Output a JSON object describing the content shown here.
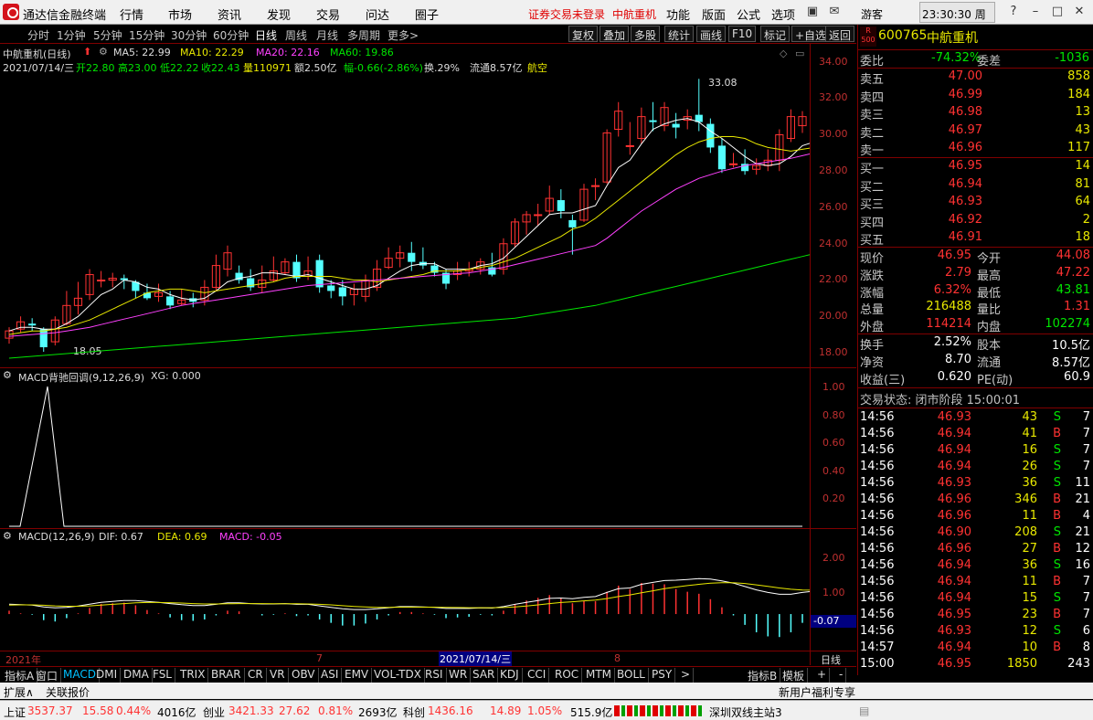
{
  "app_title": "通达信金融终端",
  "menu": [
    "行情",
    "市场",
    "资讯",
    "发现",
    "交易",
    "问达",
    "圈子"
  ],
  "menu_right": [
    "功能",
    "版面",
    "公式",
    "选项"
  ],
  "trade_warning": "证券交易未登录",
  "menu_stock": "中航重机",
  "guest": "游客",
  "clock": "23:30:30 周三",
  "periods": [
    "分时",
    "1分钟",
    "5分钟",
    "15分钟",
    "30分钟",
    "60分钟",
    "日线",
    "周线",
    "月线",
    "多周期",
    "更多>"
  ],
  "toolbar_buttons": [
    "复权",
    "叠加",
    "多股",
    "统计",
    "画线",
    "F10",
    "标记",
    "+自选",
    "返回"
  ],
  "chart_header": {
    "name": "中航重机(日线)",
    "ma5": "MA5: 22.99",
    "ma10": "MA10: 22.29",
    "ma20": "MA20: 22.16",
    "ma60": "MA60: 19.86",
    "info_date": "2021/07/14/三",
    "info_open": "开22.80",
    "info_high": "高23.00",
    "info_low": "低22.22",
    "info_close": "收22.43",
    "info_vol": "量110971",
    "info_amt": "额2.50亿",
    "info_chg": "幅-0.66(-2.86%)",
    "info_turn": "换.29%",
    "info_float": "流通8.57亿",
    "info_sector": "航空"
  },
  "price_axis": [
    "34.00",
    "32.00",
    "30.00",
    "28.00",
    "26.00",
    "24.00",
    "22.00",
    "20.00",
    "18.00"
  ],
  "high_label": "33.08",
  "low_label": "18.05",
  "indicator1": {
    "title": "MACD背驰回调(9,12,26,9)",
    "xg": "XG: 0.000",
    "axis": [
      "1.00",
      "0.80",
      "0.60",
      "0.40",
      "0.20"
    ]
  },
  "indicator2": {
    "title": "MACD(12,26,9)",
    "dif": "DIF: 0.67",
    "dea": "DEA: 0.69",
    "macd": "MACD: -0.05",
    "axis": [
      "2.00",
      "1.00"
    ],
    "current": "-0.07"
  },
  "date_axis": {
    "year": "2021年",
    "m7": "7",
    "cursor": "2021/07/14/三",
    "m8": "8",
    "period_label": "日线"
  },
  "indicator_tabs": [
    "指标A",
    "窗口",
    "MACD",
    "DMI",
    "DMA",
    "FSL",
    "TRIX",
    "BRAR",
    "CR",
    "VR",
    "OBV",
    "ASI",
    "EMV",
    "VOL-TDX",
    "RSI",
    "WR",
    "SAR",
    "KDJ",
    "CCI",
    "ROC",
    "MTM",
    "BOLL",
    "PSY",
    ">"
  ],
  "right_tabs": [
    "指标B",
    "模板",
    "+",
    "-"
  ],
  "sub_links": [
    "扩展∧",
    "关联报价"
  ],
  "promo": "新用户福利专享",
  "quote": {
    "code": "600765",
    "name": "中航重机",
    "weibi_label": "委比",
    "weibi": "-74.32%",
    "weicha_label": "委差",
    "weicha": "-1036",
    "asks": [
      {
        "label": "卖五",
        "price": "47.00",
        "vol": "858"
      },
      {
        "label": "卖四",
        "price": "46.99",
        "vol": "184"
      },
      {
        "label": "卖三",
        "price": "46.98",
        "vol": "13"
      },
      {
        "label": "卖二",
        "price": "46.97",
        "vol": "43"
      },
      {
        "label": "卖一",
        "price": "46.96",
        "vol": "117"
      }
    ],
    "bids": [
      {
        "label": "买一",
        "price": "46.95",
        "vol": "14"
      },
      {
        "label": "买二",
        "price": "46.94",
        "vol": "81"
      },
      {
        "label": "买三",
        "price": "46.93",
        "vol": "64"
      },
      {
        "label": "买四",
        "price": "46.92",
        "vol": "2"
      },
      {
        "label": "买五",
        "price": "46.91",
        "vol": "18"
      }
    ],
    "stats": [
      {
        "k1": "现价",
        "v1": "46.95",
        "k2": "今开",
        "v2": "44.08",
        "c1": "red",
        "c2": "red"
      },
      {
        "k1": "涨跌",
        "v1": "2.79",
        "k2": "最高",
        "v2": "47.22",
        "c1": "red",
        "c2": "red"
      },
      {
        "k1": "涨幅",
        "v1": "6.32%",
        "k2": "最低",
        "v2": "43.81",
        "c1": "red",
        "c2": "green"
      },
      {
        "k1": "总量",
        "v1": "216488",
        "k2": "量比",
        "v2": "1.31",
        "c1": "yellow",
        "c2": "red"
      },
      {
        "k1": "外盘",
        "v1": "114214",
        "k2": "内盘",
        "v2": "102274",
        "c1": "red",
        "c2": "green"
      }
    ],
    "stats2": [
      {
        "k1": "换手",
        "v1": "2.52%",
        "k2": "股本",
        "v2": "10.5亿"
      },
      {
        "k1": "净资",
        "v1": "8.70",
        "k2": "流通",
        "v2": "8.57亿"
      },
      {
        "k1": "收益(三)",
        "v1": "0.620",
        "k2": "PE(动)",
        "v2": "60.9"
      }
    ],
    "trade_status": "交易状态: 闭市阶段 15:00:01",
    "ticks": [
      {
        "t": "14:56",
        "p": "46.93",
        "v": "43",
        "d": "S",
        "n": "7"
      },
      {
        "t": "14:56",
        "p": "46.94",
        "v": "41",
        "d": "B",
        "n": "7"
      },
      {
        "t": "14:56",
        "p": "46.94",
        "v": "16",
        "d": "S",
        "n": "7"
      },
      {
        "t": "14:56",
        "p": "46.94",
        "v": "26",
        "d": "S",
        "n": "7"
      },
      {
        "t": "14:56",
        "p": "46.93",
        "v": "36",
        "d": "S",
        "n": "11"
      },
      {
        "t": "14:56",
        "p": "46.96",
        "v": "346",
        "d": "B",
        "n": "21"
      },
      {
        "t": "14:56",
        "p": "46.96",
        "v": "11",
        "d": "B",
        "n": "4"
      },
      {
        "t": "14:56",
        "p": "46.90",
        "v": "208",
        "d": "S",
        "n": "21"
      },
      {
        "t": "14:56",
        "p": "46.96",
        "v": "27",
        "d": "B",
        "n": "12"
      },
      {
        "t": "14:56",
        "p": "46.94",
        "v": "36",
        "d": "S",
        "n": "16"
      },
      {
        "t": "14:56",
        "p": "46.94",
        "v": "11",
        "d": "B",
        "n": "7"
      },
      {
        "t": "14:56",
        "p": "46.94",
        "v": "15",
        "d": "S",
        "n": "7"
      },
      {
        "t": "14:56",
        "p": "46.95",
        "v": "23",
        "d": "B",
        "n": "7"
      },
      {
        "t": "14:56",
        "p": "46.93",
        "v": "12",
        "d": "S",
        "n": "6"
      },
      {
        "t": "14:57",
        "p": "46.94",
        "v": "10",
        "d": "B",
        "n": "8"
      },
      {
        "t": "15:00",
        "p": "46.95",
        "v": "1850",
        "d": "",
        "n": "243"
      }
    ]
  },
  "status_bar": {
    "sh_label": "上证",
    "sh": "3537.37",
    "sh_chg": "15.58",
    "sh_pct": "0.44%",
    "sh_amt": "4016亿",
    "cy_label": "创业",
    "cy": "3421.33",
    "cy_chg": "27.62",
    "cy_pct": "0.81%",
    "cy_amt": "2693亿",
    "kc_label": "科创",
    "kc": "1436.16",
    "kc_chg": "14.89",
    "kc_pct": "1.05%",
    "kc_amt": "515.9亿",
    "server": "深圳双线主站3"
  },
  "chart_data": {
    "type": "candlestick",
    "y_range": [
      17,
      35
    ],
    "candles": [
      {
        "o": 18.8,
        "c": 19.2,
        "h": 19.4,
        "l": 18.5
      },
      {
        "o": 19.3,
        "c": 19.7,
        "h": 20.0,
        "l": 19.1
      },
      {
        "o": 19.6,
        "c": 19.5,
        "h": 19.9,
        "l": 19.2
      },
      {
        "o": 19.3,
        "c": 18.3,
        "h": 19.4,
        "l": 18.05
      },
      {
        "o": 18.6,
        "c": 19.8,
        "h": 20.0,
        "l": 18.4
      },
      {
        "o": 19.6,
        "c": 20.6,
        "h": 21.4,
        "l": 19.5
      },
      {
        "o": 20.6,
        "c": 21.0,
        "h": 21.9,
        "l": 20.1
      },
      {
        "o": 21.2,
        "c": 22.3,
        "h": 22.6,
        "l": 20.9
      },
      {
        "o": 22.0,
        "c": 22.0,
        "h": 22.5,
        "l": 21.6
      },
      {
        "o": 22.0,
        "c": 22.1,
        "h": 22.4,
        "l": 21.6
      },
      {
        "o": 22.1,
        "c": 22.0,
        "h": 22.3,
        "l": 21.5
      },
      {
        "o": 21.9,
        "c": 21.4,
        "h": 22.0,
        "l": 21.0
      },
      {
        "o": 21.3,
        "c": 21.0,
        "h": 21.8,
        "l": 20.9
      },
      {
        "o": 21.1,
        "c": 21.3,
        "h": 21.8,
        "l": 20.8
      },
      {
        "o": 21.1,
        "c": 20.6,
        "h": 21.4,
        "l": 20.4
      },
      {
        "o": 20.7,
        "c": 20.9,
        "h": 21.5,
        "l": 20.6
      },
      {
        "o": 21.0,
        "c": 20.8,
        "h": 21.3,
        "l": 20.5
      },
      {
        "o": 20.9,
        "c": 21.6,
        "h": 22.0,
        "l": 20.6
      },
      {
        "o": 21.6,
        "c": 22.8,
        "h": 23.4,
        "l": 21.4
      },
      {
        "o": 22.6,
        "c": 23.5,
        "h": 23.9,
        "l": 22.2
      },
      {
        "o": 22.4,
        "c": 22.0,
        "h": 22.8,
        "l": 21.8
      },
      {
        "o": 22.1,
        "c": 21.6,
        "h": 22.6,
        "l": 21.4
      },
      {
        "o": 21.6,
        "c": 22.0,
        "h": 22.8,
        "l": 21.3
      },
      {
        "o": 22.0,
        "c": 22.5,
        "h": 23.3,
        "l": 21.9
      },
      {
        "o": 22.4,
        "c": 23.0,
        "h": 23.2,
        "l": 22.3
      },
      {
        "o": 23.0,
        "c": 22.1,
        "h": 23.4,
        "l": 21.9
      },
      {
        "o": 22.2,
        "c": 22.5,
        "h": 23.3,
        "l": 22.0
      },
      {
        "o": 23.1,
        "c": 21.6,
        "h": 23.4,
        "l": 21.3
      },
      {
        "o": 21.7,
        "c": 21.4,
        "h": 22.0,
        "l": 21.0
      },
      {
        "o": 21.6,
        "c": 21.1,
        "h": 22.0,
        "l": 20.6
      },
      {
        "o": 21.2,
        "c": 21.5,
        "h": 21.8,
        "l": 20.6
      },
      {
        "o": 21.1,
        "c": 22.0,
        "h": 22.3,
        "l": 20.8
      },
      {
        "o": 21.6,
        "c": 22.6,
        "h": 23.1,
        "l": 21.4
      },
      {
        "o": 22.7,
        "c": 23.2,
        "h": 23.8,
        "l": 22.6
      },
      {
        "o": 23.2,
        "c": 23.5,
        "h": 23.9,
        "l": 22.7
      },
      {
        "o": 23.5,
        "c": 23.0,
        "h": 24.1,
        "l": 22.5
      },
      {
        "o": 23.0,
        "c": 22.8,
        "h": 23.8,
        "l": 22.6
      },
      {
        "o": 22.8,
        "c": 22.4,
        "h": 23.0,
        "l": 22.2
      },
      {
        "o": 22.4,
        "c": 21.8,
        "h": 22.6,
        "l": 21.5
      },
      {
        "o": 22.3,
        "c": 22.5,
        "h": 23.0,
        "l": 22.0
      },
      {
        "o": 22.5,
        "c": 22.6,
        "h": 23.0,
        "l": 22.2
      },
      {
        "o": 22.6,
        "c": 23.0,
        "h": 23.2,
        "l": 22.3
      },
      {
        "o": 22.7,
        "c": 22.3,
        "h": 23.5,
        "l": 22.2
      },
      {
        "o": 22.6,
        "c": 24.0,
        "h": 24.3,
        "l": 22.3
      },
      {
        "o": 24.0,
        "c": 25.2,
        "h": 25.4,
        "l": 23.8
      },
      {
        "o": 25.2,
        "c": 25.6,
        "h": 25.8,
        "l": 24.5
      },
      {
        "o": 25.6,
        "c": 25.6,
        "h": 26.2,
        "l": 25.0
      },
      {
        "o": 25.8,
        "c": 26.5,
        "h": 27.2,
        "l": 25.6
      },
      {
        "o": 26.4,
        "c": 25.8,
        "h": 27.0,
        "l": 25.4
      },
      {
        "o": 25.3,
        "c": 24.9,
        "h": 25.6,
        "l": 23.4
      },
      {
        "o": 25.3,
        "c": 27.0,
        "h": 27.3,
        "l": 25.2
      },
      {
        "o": 27.2,
        "c": 27.2,
        "h": 27.6,
        "l": 26.4
      },
      {
        "o": 27.4,
        "c": 30.1,
        "h": 30.3,
        "l": 27.3
      },
      {
        "o": 30.3,
        "c": 31.3,
        "h": 31.8,
        "l": 29.9
      },
      {
        "o": 29.4,
        "c": 29.4,
        "h": 30.7,
        "l": 28.9
      },
      {
        "o": 29.8,
        "c": 31.0,
        "h": 31.5,
        "l": 29.5
      },
      {
        "o": 30.8,
        "c": 30.7,
        "h": 31.8,
        "l": 30.2
      },
      {
        "o": 30.5,
        "c": 31.5,
        "h": 31.8,
        "l": 30.2
      },
      {
        "o": 30.6,
        "c": 30.4,
        "h": 31.2,
        "l": 29.8
      },
      {
        "o": 30.8,
        "c": 31.0,
        "h": 31.4,
        "l": 30.3
      },
      {
        "o": 31.1,
        "c": 30.7,
        "h": 33.08,
        "l": 30.2
      },
      {
        "o": 30.6,
        "c": 29.3,
        "h": 30.9,
        "l": 29.0
      },
      {
        "o": 29.4,
        "c": 28.1,
        "h": 29.8,
        "l": 27.9
      },
      {
        "o": 28.4,
        "c": 28.4,
        "h": 29.0,
        "l": 28.2
      },
      {
        "o": 28.4,
        "c": 28.0,
        "h": 29.2,
        "l": 27.8
      },
      {
        "o": 28.1,
        "c": 28.3,
        "h": 28.7,
        "l": 27.8
      },
      {
        "o": 28.3,
        "c": 28.6,
        "h": 29.2,
        "l": 28.0
      },
      {
        "o": 28.6,
        "c": 30.0,
        "h": 30.3,
        "l": 28.0
      },
      {
        "o": 29.8,
        "c": 31.0,
        "h": 31.4,
        "l": 29.6
      },
      {
        "o": 30.5,
        "c": 31.0,
        "h": 31.3,
        "l": 30.1
      }
    ],
    "ma5": [
      19.2,
      19.4,
      19.4,
      19.3,
      19.3,
      19.6,
      20.0,
      20.6,
      21.2,
      21.5,
      22.0,
      21.9,
      21.6,
      21.5,
      21.2,
      21.0,
      20.9,
      21.0,
      21.4,
      21.9,
      22.1,
      22.2,
      22.4,
      22.4,
      22.3,
      22.2,
      22.3,
      22.1,
      21.9,
      21.7,
      21.5,
      21.5,
      21.7,
      22.1,
      22.5,
      22.8,
      22.9,
      22.9,
      22.6,
      22.6,
      22.6,
      22.8,
      22.9,
      23.2,
      23.8,
      24.4,
      25.0,
      25.6,
      25.7,
      25.7,
      25.9,
      26.1,
      27.2,
      28.2,
      28.6,
      29.5,
      30.3,
      30.6,
      30.8,
      30.9,
      30.7,
      30.2,
      29.8,
      29.3,
      28.8,
      28.4,
      28.3,
      28.4,
      28.8,
      29.4,
      29.6
    ],
    "ma10": [
      19.0,
      19.1,
      19.2,
      19.2,
      19.3,
      19.4,
      19.6,
      19.8,
      20.1,
      20.4,
      20.7,
      21.0,
      21.3,
      21.4,
      21.5,
      21.5,
      21.4,
      21.3,
      21.4,
      21.5,
      21.6,
      21.7,
      21.8,
      21.9,
      22.1,
      22.2,
      22.2,
      22.2,
      22.2,
      22.1,
      22.0,
      22.0,
      21.9,
      22.0,
      22.1,
      22.2,
      22.3,
      22.5,
      22.5,
      22.5,
      22.6,
      22.7,
      22.8,
      23.0,
      23.2,
      23.5,
      23.8,
      24.1,
      24.4,
      24.8,
      25.0,
      25.4,
      25.9,
      26.4,
      26.9,
      27.4,
      27.9,
      28.4,
      28.9,
      29.3,
      29.6,
      29.8,
      29.9,
      29.9,
      29.8,
      29.5,
      29.3,
      29.2,
      29.1,
      29.2,
      29.3
    ],
    "ma20": [
      18.9,
      18.95,
      19.0,
      19.05,
      19.1,
      19.2,
      19.3,
      19.4,
      19.55,
      19.7,
      19.85,
      20.0,
      20.15,
      20.3,
      20.45,
      20.6,
      20.7,
      20.8,
      20.9,
      21.0,
      21.1,
      21.2,
      21.3,
      21.4,
      21.5,
      21.6,
      21.7,
      21.75,
      21.8,
      21.85,
      21.9,
      21.95,
      22.0,
      22.05,
      22.1,
      22.15,
      22.2,
      22.25,
      22.3,
      22.35,
      22.4,
      22.5,
      22.6,
      22.7,
      22.85,
      23.0,
      23.15,
      23.3,
      23.45,
      23.6,
      23.75,
      23.9,
      24.3,
      24.8,
      25.3,
      25.8,
      26.2,
      26.6,
      27.0,
      27.3,
      27.6,
      27.8,
      28.0,
      28.15,
      28.3,
      28.4,
      28.5,
      28.6,
      28.7,
      28.85,
      29.0
    ],
    "ma60": [
      17.7,
      17.75,
      17.8,
      17.85,
      17.9,
      17.95,
      18.0,
      18.05,
      18.1,
      18.15,
      18.2,
      18.25,
      18.3,
      18.35,
      18.4,
      18.45,
      18.5,
      18.55,
      18.6,
      18.65,
      18.7,
      18.75,
      18.8,
      18.85,
      18.9,
      18.95,
      19.0,
      19.05,
      19.1,
      19.15,
      19.2,
      19.25,
      19.3,
      19.35,
      19.4,
      19.45,
      19.5,
      19.55,
      19.6,
      19.65,
      19.7,
      19.75,
      19.8,
      19.85,
      19.9,
      20.0,
      20.1,
      20.2,
      20.3,
      20.4,
      20.5,
      20.6,
      20.75,
      20.9,
      21.05,
      21.2,
      21.35,
      21.5,
      21.65,
      21.8,
      21.95,
      22.1,
      22.25,
      22.4,
      22.55,
      22.7,
      22.85,
      23.0,
      23.15,
      23.3,
      23.45
    ],
    "dif": [
      0.35,
      0.32,
      0.3,
      0.2,
      0.15,
      0.18,
      0.25,
      0.35,
      0.45,
      0.5,
      0.55,
      0.55,
      0.5,
      0.45,
      0.38,
      0.32,
      0.28,
      0.28,
      0.34,
      0.42,
      0.42,
      0.38,
      0.36,
      0.36,
      0.38,
      0.34,
      0.34,
      0.26,
      0.18,
      0.1,
      0.06,
      0.06,
      0.1,
      0.16,
      0.22,
      0.22,
      0.2,
      0.18,
      0.12,
      0.12,
      0.12,
      0.15,
      0.14,
      0.22,
      0.34,
      0.45,
      0.55,
      0.66,
      0.68,
      0.64,
      0.72,
      0.76,
      0.98,
      1.18,
      1.22,
      1.42,
      1.52,
      1.62,
      1.64,
      1.68,
      1.72,
      1.7,
      1.6,
      1.48,
      1.3,
      1.12,
      0.98,
      0.88,
      0.88,
      0.98,
      1.05
    ],
    "dea": [
      0.3,
      0.31,
      0.31,
      0.29,
      0.26,
      0.24,
      0.24,
      0.26,
      0.3,
      0.34,
      0.38,
      0.42,
      0.44,
      0.44,
      0.43,
      0.41,
      0.38,
      0.36,
      0.36,
      0.37,
      0.38,
      0.38,
      0.38,
      0.37,
      0.37,
      0.37,
      0.36,
      0.34,
      0.31,
      0.27,
      0.23,
      0.2,
      0.18,
      0.18,
      0.19,
      0.19,
      0.19,
      0.19,
      0.18,
      0.17,
      0.16,
      0.16,
      0.16,
      0.17,
      0.2,
      0.25,
      0.31,
      0.38,
      0.44,
      0.48,
      0.53,
      0.57,
      0.65,
      0.76,
      0.85,
      0.96,
      1.07,
      1.18,
      1.27,
      1.35,
      1.42,
      1.48,
      1.5,
      1.5,
      1.46,
      1.39,
      1.31,
      1.22,
      1.15,
      1.11,
      1.1
    ],
    "signal": [
      {
        "i": 0,
        "v": 1.0
      }
    ]
  }
}
